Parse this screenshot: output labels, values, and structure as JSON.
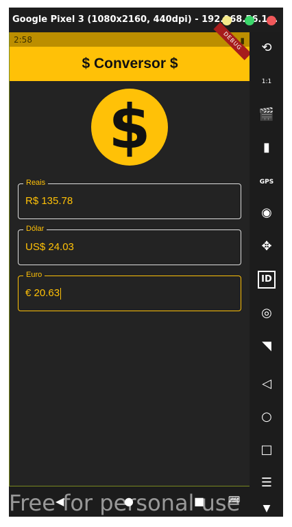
{
  "window": {
    "title": "Google Pixel 3 (1080x2160, 440dpi) - 192.168.56.1...",
    "colors": {
      "minimize": "#f5e98a",
      "maximize": "#3bd66a",
      "close": "#f0585a"
    }
  },
  "status_bar": {
    "time": "2:58"
  },
  "app_bar": {
    "title": "$ Conversor $",
    "debug_banner": "DEBUG"
  },
  "hero": {
    "icon": "dollar-coin-icon",
    "glyph": "$"
  },
  "fields": [
    {
      "label": "Reais",
      "value": "R$ 135.78"
    },
    {
      "label": "Dólar",
      "value": "US$ 24.03"
    },
    {
      "label": "Euro",
      "value": "€ 20.63"
    }
  ],
  "sidebar": {
    "icons": [
      "rotate-icon",
      "one-to-one-icon",
      "media-icon",
      "battery-icon",
      "gps-icon",
      "camera-icon",
      "dpad-icon",
      "id-icon",
      "fingerprint-icon",
      "cast-icon",
      "back-icon",
      "home-icon",
      "overview-icon",
      "menu-icon",
      "chevron-down-icon"
    ],
    "gps_label": "GPS",
    "id_label": "ID",
    "scale_label": "1:1"
  },
  "watermark": {
    "text": "Free for personal use"
  },
  "accent": "#ffc107"
}
